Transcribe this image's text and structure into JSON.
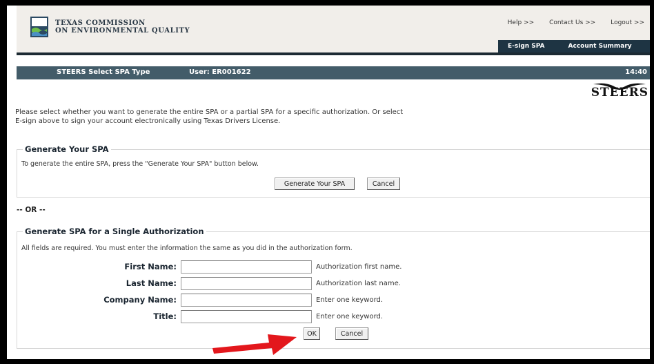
{
  "header": {
    "agency_line1": "TEXAS COMMISSION",
    "agency_line2": "ON ENVIRONMENTAL QUALITY",
    "links": [
      "Help >>",
      "Contact Us >>",
      "Logout >>"
    ],
    "tabs": [
      "E-sign SPA",
      "Account Summary"
    ]
  },
  "titlebar": {
    "page_title": "STEERS Select SPA Type",
    "user": "User: ER001622",
    "time": "14:40"
  },
  "brand": "STEERS",
  "intro_line1": "Please select whether you want to generate the entire SPA or a partial SPA for a specific authorization. Or select",
  "intro_line2": "E-sign above to sign your account electronically using Texas Drivers License.",
  "generate_section": {
    "legend": "Generate Your SPA",
    "description": "To generate the entire SPA, press the \"Generate Your SPA\" button below.",
    "generate_button": "Generate Your SPA",
    "cancel_button": "Cancel"
  },
  "separator": "-- OR --",
  "single_section": {
    "legend": "Generate SPA for a Single Authorization",
    "description": "All fields are required. You must enter the information the same as you did in the authorization form.",
    "fields": [
      {
        "label": "First Name:",
        "value": "",
        "hint": "Authorization first name."
      },
      {
        "label": "Last Name:",
        "value": "",
        "hint": "Authorization last name."
      },
      {
        "label": "Company Name:",
        "value": "",
        "hint": "Enter one keyword."
      },
      {
        "label": "Title:",
        "value": "",
        "hint": "Enter one keyword."
      }
    ],
    "ok_button": "OK",
    "cancel_button": "Cancel"
  },
  "annotation": {
    "arrow_color": "#e3171c"
  },
  "colors": {
    "titlebar": "#435c69",
    "nav": "#1e3443"
  }
}
